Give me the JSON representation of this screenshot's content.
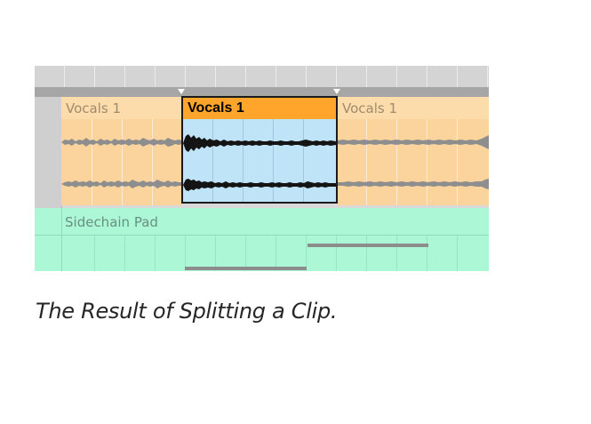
{
  "arrangement": {
    "tracks": {
      "vocals": {
        "clips": [
          {
            "title": "Vocals 1",
            "selected": false,
            "color": "#fcdaa6"
          },
          {
            "title": "Vocals 1",
            "selected": true,
            "color": "#ffa52b"
          },
          {
            "title": "Vocals 1",
            "selected": false,
            "color": "#fcdaa6"
          }
        ]
      },
      "sidechain_pad": {
        "title": "Sidechain Pad",
        "color": "#abf7d6"
      }
    }
  },
  "caption": "The Result of Splitting a Clip."
}
